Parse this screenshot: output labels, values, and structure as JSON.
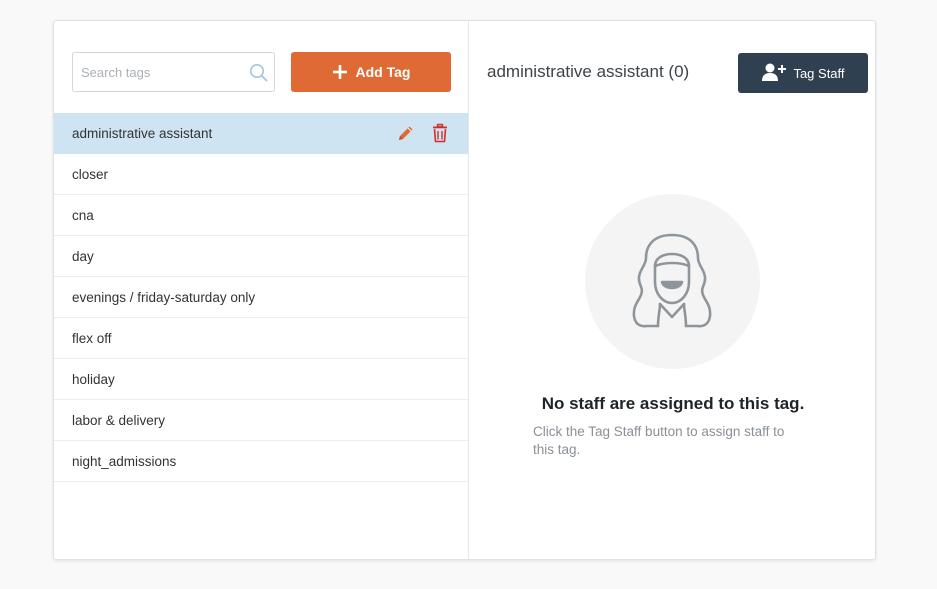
{
  "search": {
    "placeholder": "Search tags",
    "value": "",
    "icon": "search-icon"
  },
  "add_button": {
    "label": "Add Tag",
    "icon": "plus-icon"
  },
  "tags": [
    {
      "label": "administrative assistant",
      "selected": true
    },
    {
      "label": "closer"
    },
    {
      "label": "cna"
    },
    {
      "label": "day"
    },
    {
      "label": "evenings / friday-saturday only"
    },
    {
      "label": "flex off"
    },
    {
      "label": "holiday"
    },
    {
      "label": "labor & delivery"
    },
    {
      "label": "night_admissions"
    }
  ],
  "row_actions": {
    "edit_icon": "pencil-icon",
    "delete_icon": "trash-icon"
  },
  "detail": {
    "title": "administrative assistant (0)",
    "tag_staff_button": {
      "label": "Tag Staff",
      "icon": "add-person-icon"
    },
    "empty_title": "No staff are assigned to this tag.",
    "empty_desc": "Click the Tag Staff button to assign staff to this tag.",
    "avatar_icon": "person-placeholder-icon"
  },
  "colors": {
    "accent": "#e06a35",
    "dark_button": "#2f4150",
    "selected_row": "#cfe4f3",
    "delete_red": "#d0312d",
    "edit_orange": "#e06a35"
  }
}
